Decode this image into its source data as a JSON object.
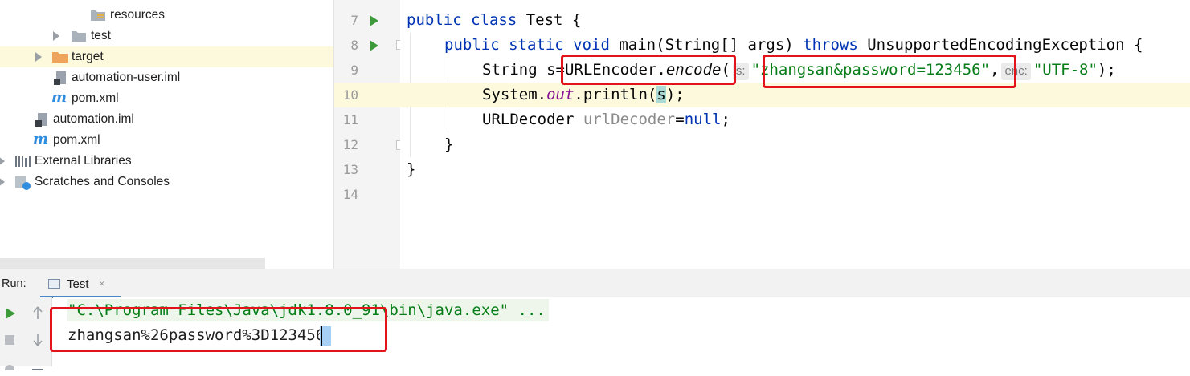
{
  "project_tree": {
    "items": [
      {
        "label": "resources",
        "icon": "resources-folder-icon",
        "indent": 3,
        "arrow": false,
        "selected": false
      },
      {
        "label": "test",
        "icon": "folder-icon",
        "indent": 2,
        "arrow": true,
        "selected": false
      },
      {
        "label": "target",
        "icon": "orange-folder-icon",
        "indent": 1,
        "arrow": true,
        "selected": true
      },
      {
        "label": "automation-user.iml",
        "icon": "iml-file-icon",
        "indent": 1,
        "arrow": false,
        "selected": false
      },
      {
        "label": "pom.xml",
        "icon": "maven-icon",
        "indent": 1,
        "arrow": false,
        "selected": false
      },
      {
        "label": "automation.iml",
        "icon": "iml-file-icon",
        "indent": 0,
        "arrow": false,
        "selected": false
      },
      {
        "label": "pom.xml",
        "icon": "maven-icon",
        "indent": 0,
        "arrow": false,
        "selected": false
      },
      {
        "label": "External Libraries",
        "icon": "libraries-icon",
        "indent": -1,
        "arrow": true,
        "selected": false
      },
      {
        "label": "Scratches and Consoles",
        "icon": "scratches-icon",
        "indent": -1,
        "arrow": true,
        "selected": false
      }
    ]
  },
  "editor": {
    "line_numbers": [
      "7",
      "8",
      "9",
      "10",
      "11",
      "12",
      "13",
      "14"
    ],
    "l7": {
      "kw": "public class",
      "rest": " Test {"
    },
    "l8": {
      "kw1": "public static void",
      "name": "main",
      "args": "(String[] args) ",
      "kw2": "throws",
      "rest": " UnsupportedEncodingException {"
    },
    "l9": {
      "type": "String ",
      "var": "s",
      "eq": "=",
      "cls": "URLEncoder.",
      "method": "encode",
      "paren": "(",
      "hint1": "s:",
      "str1": "\"zhangsan&password=123456\"",
      "comma": ",",
      "hint2": "enc:",
      "str2": "\"UTF-8\"",
      "end": ");"
    },
    "l10": {
      "pre": "System.",
      "field": "out",
      "mid": ".println(",
      "arg": "s",
      "end": ");"
    },
    "l11": {
      "type": "URLDecoder ",
      "var": "urlDecoder",
      "eq": "=",
      "kw": "null",
      "end": ";"
    },
    "l12": {
      "text": "}"
    },
    "l13": {
      "text": "}"
    }
  },
  "run_panel": {
    "label": "Run:",
    "tab_label": "Test",
    "tab_close": "×",
    "console": {
      "line1": "\"C:\\Program Files\\Java\\jdk1.8.0_91\\bin\\java.exe\" ...",
      "line2": "zhangsan%26password%3D123456"
    }
  },
  "colors": {
    "keyword": "#0033b3",
    "string": "#067d17",
    "field": "#871094",
    "annotation_box": "#e3131b",
    "current_line": "#fcf9dc"
  }
}
